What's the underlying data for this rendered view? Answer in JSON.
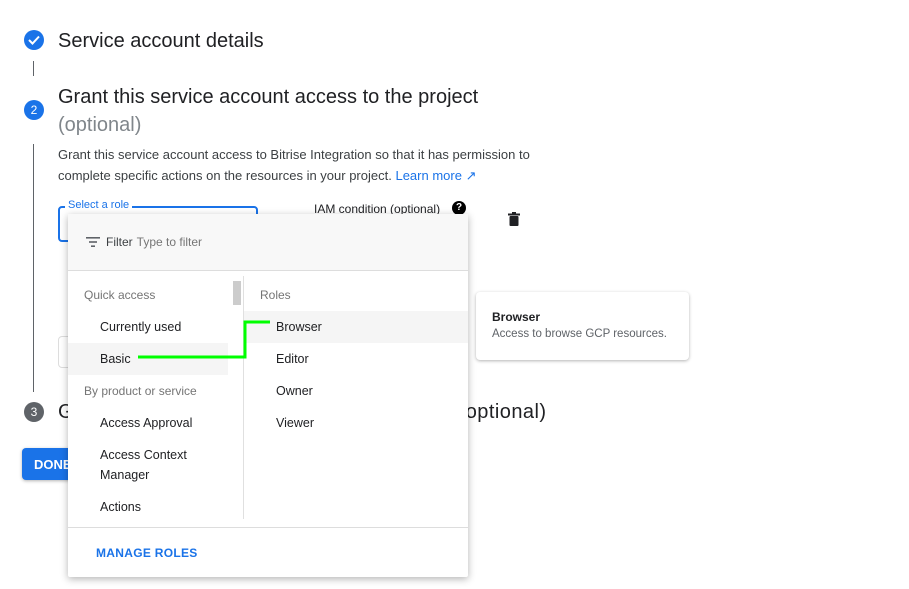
{
  "steps": [
    {
      "title": "Service account details"
    },
    {
      "number": "2",
      "title": "Grant this service account access to the project",
      "optional": "(optional)",
      "description": "Grant this service account access to Bitrise Integration so that it has permission to complete specific actions on the resources in your project.",
      "learn_more": "Learn more"
    },
    {
      "number": "3",
      "title": "Grant users access to this service account (optional)"
    }
  ],
  "role_field": {
    "label": "Select a role"
  },
  "iam_condition": {
    "label": "IAM condition (optional)"
  },
  "done_button": "DONE",
  "dropdown": {
    "filter_label": "Filter",
    "filter_placeholder": "Type to filter",
    "left": {
      "sections": [
        {
          "title": "Quick access",
          "items": [
            "Currently used",
            "Basic"
          ]
        },
        {
          "title": "By product or service",
          "items": [
            "Access Approval",
            "Access Context Manager",
            "Actions"
          ]
        }
      ],
      "selected": "Basic"
    },
    "right": {
      "title": "Roles",
      "items": [
        "Browser",
        "Editor",
        "Owner",
        "Viewer"
      ],
      "selected": "Browser"
    },
    "manage_roles": "MANAGE ROLES"
  },
  "tooltip": {
    "title": "Browser",
    "description": "Access to browse GCP resources."
  },
  "colors": {
    "accent": "#1a73e8",
    "highlight": "#00ff00"
  }
}
